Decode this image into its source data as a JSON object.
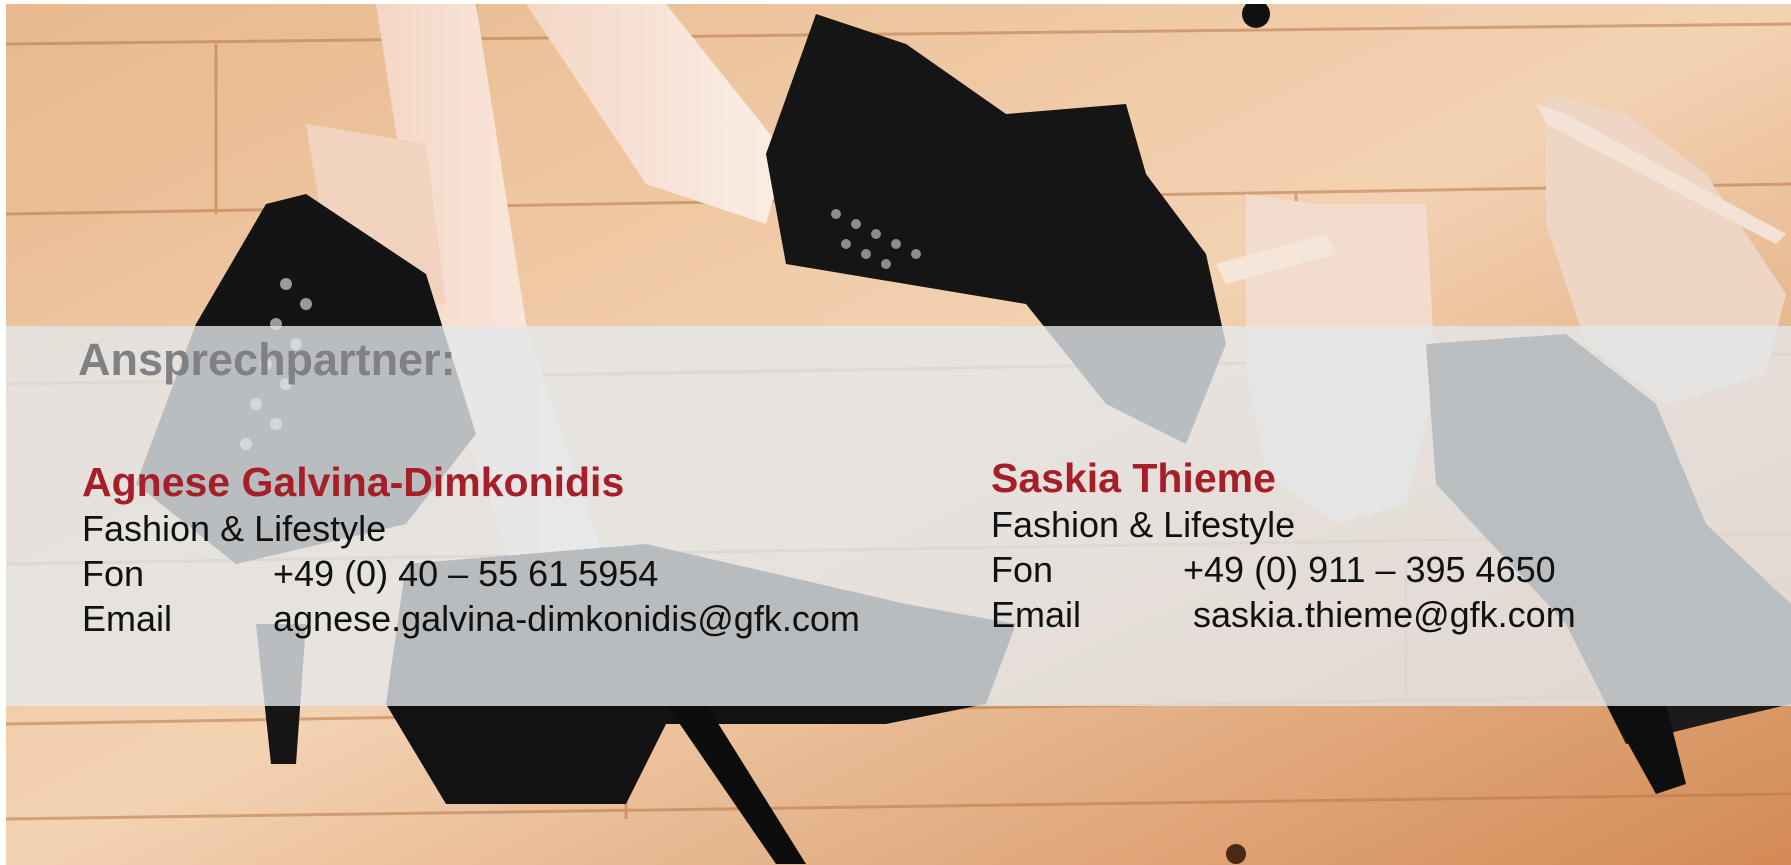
{
  "heading": "Ansprechpartner:",
  "contacts": [
    {
      "name": "Agnese Galvina-Dimkonidis",
      "department": "Fashion & Lifestyle",
      "phone_label": "Fon",
      "phone": "+49 (0) 40 – 55 61 5954",
      "email_label": "Email",
      "email": "agnese.galvina-dimkonidis@gfk.com"
    },
    {
      "name": "Saskia Thieme",
      "department": "Fashion & Lifestyle",
      "phone_label": "Fon",
      "phone": "+49 (0) 911 – 395 4650",
      "email_label": "Email",
      "email": "saskia.thieme@gfk.com"
    }
  ],
  "colors": {
    "name_accent": "#a61e28",
    "heading_gray": "#7f8184",
    "band_overlay": "#e4e7eb",
    "floor_wood": "#d99a68"
  },
  "background_image": "shoes-on-wooden-floor-photo"
}
